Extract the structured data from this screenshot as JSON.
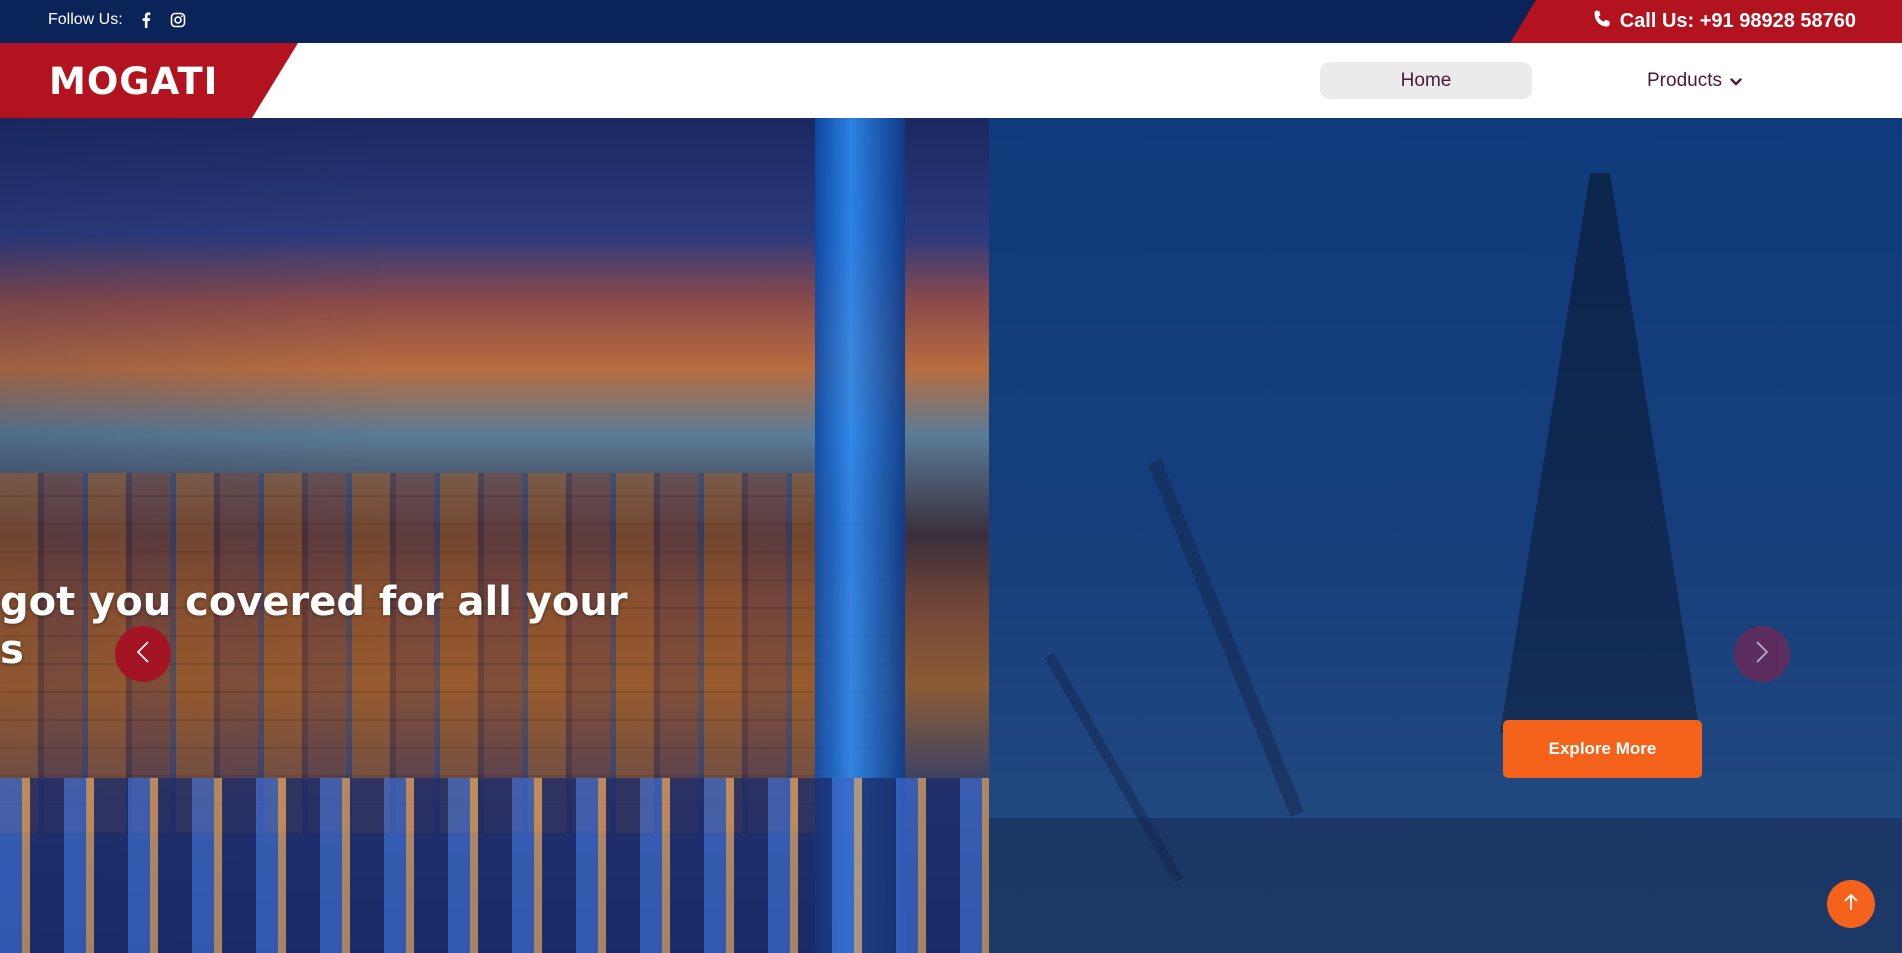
{
  "topbar": {
    "follow_label": "Follow Us:",
    "social": [
      {
        "icon": "facebook-icon"
      },
      {
        "icon": "instagram-icon"
      }
    ],
    "call_label": "Call Us: +91 98928 58760"
  },
  "header": {
    "logo": "MOGATI",
    "nav": [
      {
        "label": "Home",
        "active": true
      },
      {
        "label": "Products",
        "has_dropdown": true
      }
    ]
  },
  "hero": {
    "headline_line1": "got you covered for all your",
    "headline_line2": "s",
    "explore_label": "Explore More"
  },
  "colors": {
    "navy": "#0a2359",
    "brand_red": "#b3121f",
    "accent_orange": "#f5621c",
    "nav_text": "#4a1a38"
  }
}
